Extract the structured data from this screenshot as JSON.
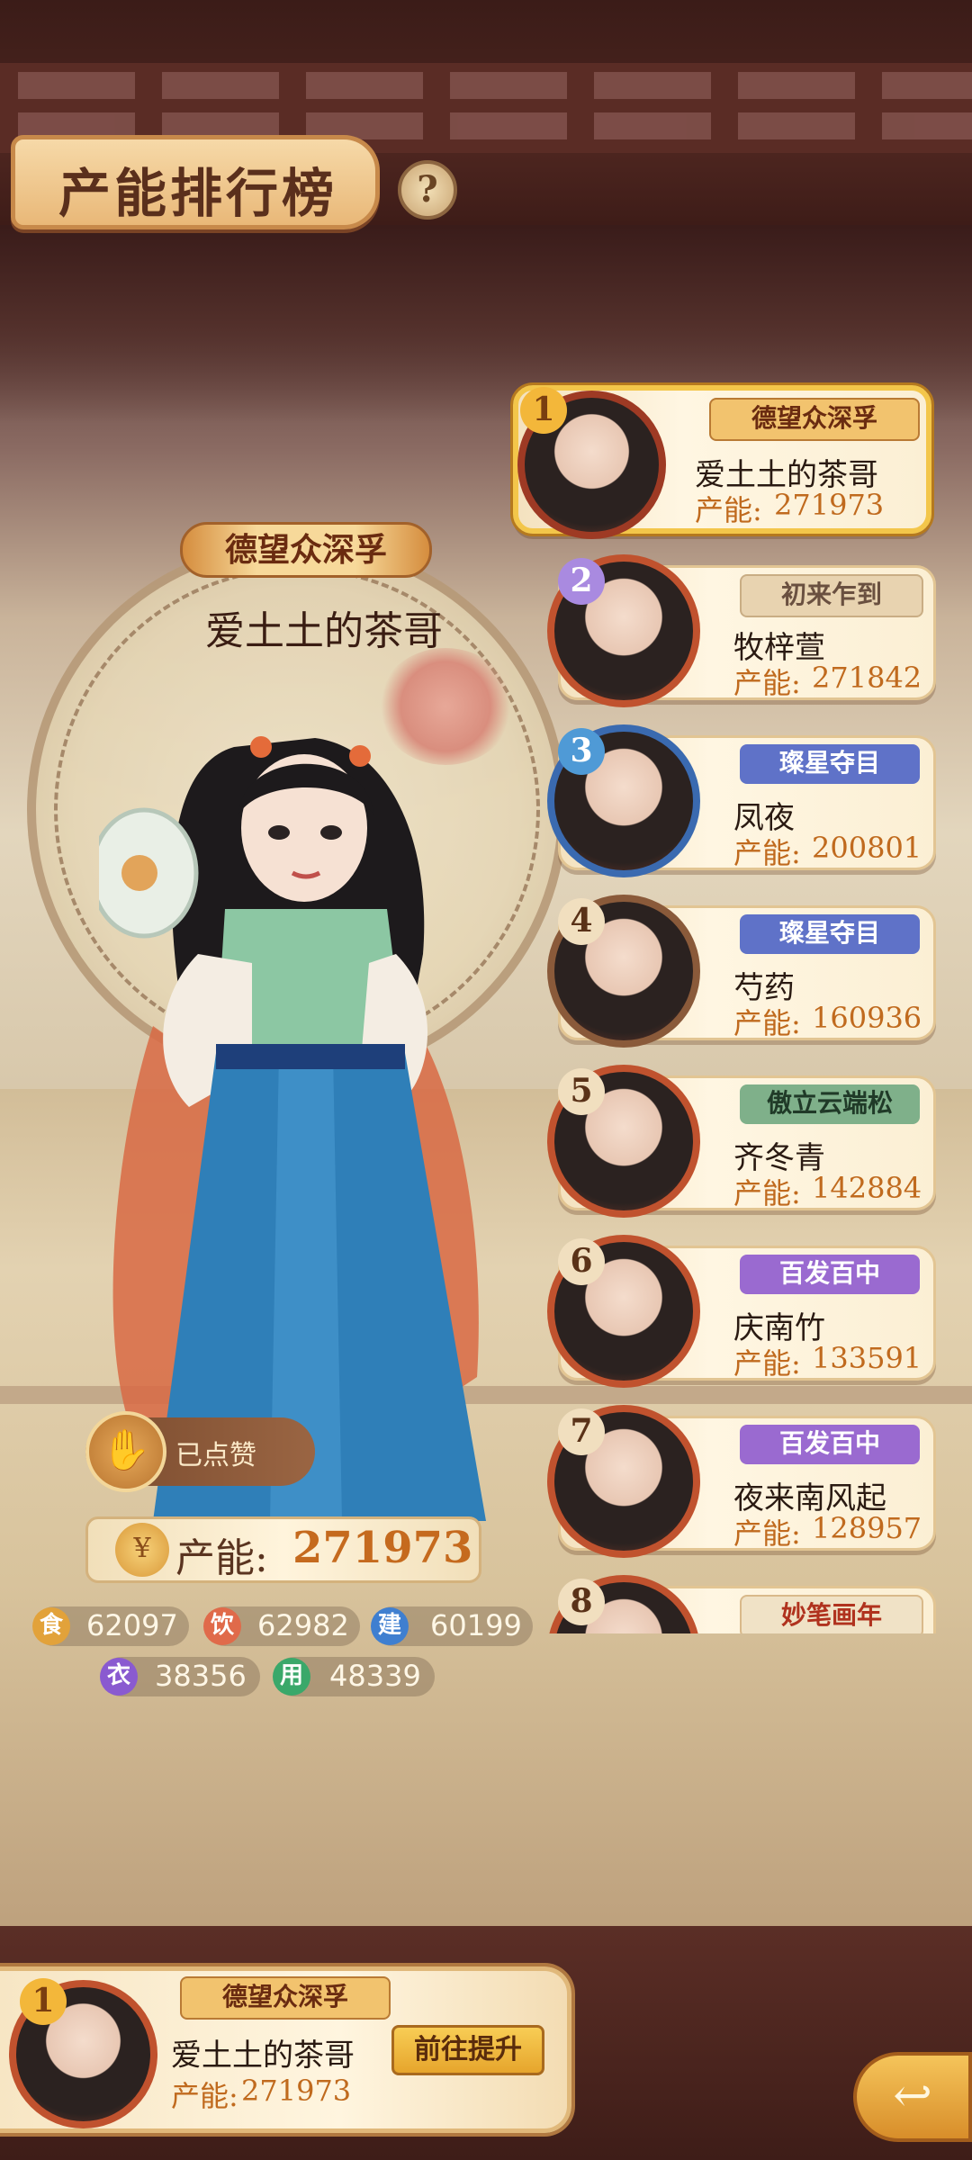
{
  "header": {
    "title": "产能排行榜",
    "help_icon": "?"
  },
  "player": {
    "title_badge": "德望众深孚",
    "name": "爱土土的茶哥",
    "like_label": "已点赞",
    "capacity_label": "产能:",
    "capacity_value": "271973",
    "stats": [
      {
        "icon": "食",
        "value": "62097",
        "color": "#e2a23a"
      },
      {
        "icon": "饮",
        "value": "62982",
        "color": "#e06a4a"
      },
      {
        "icon": "建",
        "value": "60199",
        "color": "#3f7fd0"
      },
      {
        "icon": "衣",
        "value": "38356",
        "color": "#8a5ad0"
      },
      {
        "icon": "用",
        "value": "48339",
        "color": "#3aa86a"
      }
    ]
  },
  "ranking": [
    {
      "rank": "1",
      "name": "爱土土的茶哥",
      "score_label": "产能:",
      "score": "271973",
      "badge": "德望众深孚",
      "badge_color": "#f2c36e"
    },
    {
      "rank": "2",
      "name": "牧梓萱",
      "score_label": "产能:",
      "score": "271842",
      "badge": "初来乍到",
      "badge_color": "#e8d3b0"
    },
    {
      "rank": "3",
      "name": "凤夜",
      "score_label": "产能:",
      "score": "200801",
      "badge": "璨星夺目",
      "badge_color": "#5f72c8"
    },
    {
      "rank": "4",
      "name": "芍药",
      "score_label": "产能:",
      "score": "160936",
      "badge": "璨星夺目",
      "badge_color": "#5f72c8"
    },
    {
      "rank": "5",
      "name": "齐冬青",
      "score_label": "产能:",
      "score": "142884",
      "badge": "傲立云端松",
      "badge_color": "#7fb08a"
    },
    {
      "rank": "6",
      "name": "庆南竹",
      "score_label": "产能:",
      "score": "133591",
      "badge": "百发百中",
      "badge_color": "#9a6ad0"
    },
    {
      "rank": "7",
      "name": "夜来南风起",
      "score_label": "产能:",
      "score": "128957",
      "badge": "百发百中",
      "badge_color": "#9a6ad0"
    },
    {
      "rank": "8",
      "name": "",
      "score_label": "",
      "score": "",
      "badge": "妙笔画年",
      "badge_color": "#f0e2c6"
    }
  ],
  "self": {
    "rank": "1",
    "badge": "德望众深孚",
    "name": "爱土土的茶哥",
    "score_label": "产能:",
    "score": "271973",
    "goto_label": "前往提升"
  }
}
